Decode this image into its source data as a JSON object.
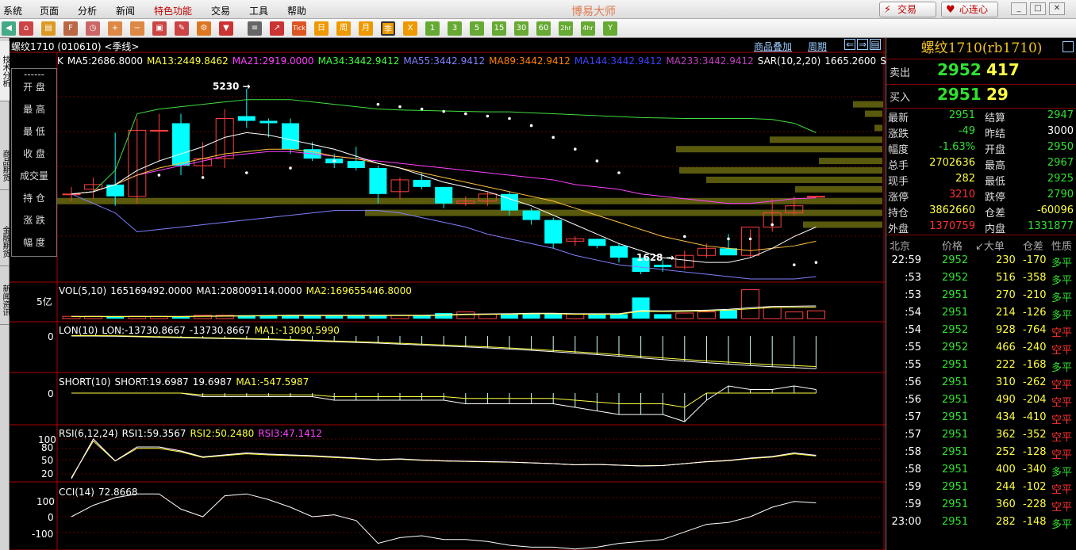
{
  "menu": [
    "系统",
    "页面",
    "分析",
    "新闻",
    "特色功能",
    "交易",
    "工具",
    "帮助"
  ],
  "app_title": "博易大师",
  "top_buttons": {
    "trade": "交易",
    "heart": "心连心"
  },
  "toolbar_labels": {
    "tick": "Tick",
    "day": "日",
    "week": "周",
    "month": "月",
    "season": "季",
    "x": "X",
    "m1": "1",
    "m3": "3",
    "m5": "5",
    "m15": "15",
    "m30": "30",
    "m60": "60",
    "h2": "2hr",
    "h4": "4hr",
    "y": "Y"
  },
  "left_tabs": [
    "技术分析",
    "商品期货",
    "金融期货",
    "新闻资讯"
  ],
  "chart": {
    "contract": "螺纹1710 (010610) <季线>",
    "links": [
      "商品叠加",
      "周期"
    ],
    "ma_line": [
      {
        "t": "K",
        "c": "#ffffff"
      },
      {
        "t": "MA5:2686.8000",
        "c": "#ffffff"
      },
      {
        "t": "MA13:2449.8462",
        "c": "#ffff40"
      },
      {
        "t": "MA21:2919.0000",
        "c": "#ff40ff"
      },
      {
        "t": "MA34:3442.9412",
        "c": "#40ff40"
      },
      {
        "t": "MA55:3442.9412",
        "c": "#8080ff"
      },
      {
        "t": "MA89:3442.9412",
        "c": "#ff8000"
      },
      {
        "t": "MA144:3442.9412",
        "c": "#4040ff"
      },
      {
        "t": "MA233:3442.9412",
        "c": "#c040c0"
      },
      {
        "t": "SAR(10,2,20)",
        "c": "#ffffff"
      },
      {
        "t": "1665.2600",
        "c": "#ffffff"
      },
      {
        "t": "SSLO",
        "c": "#ffffff"
      },
      {
        "t": "2990.5",
        "c": "#ffff40"
      }
    ],
    "side_panel": [
      "------",
      "开 盘",
      "最 高",
      "最 低",
      "收 盘",
      "成交量",
      "持 仓",
      "涨 跌",
      "幅 度"
    ],
    "price_labels": {
      "high": "5230",
      "low": "1628"
    },
    "vol_line": [
      {
        "t": "VOL(5,10)",
        "c": "#ffffff"
      },
      {
        "t": "165169492.0000",
        "c": "#ffffff"
      },
      {
        "t": "MA1:208009114.0000",
        "c": "#ffffff"
      },
      {
        "t": "MA2:169655446.8000",
        "c": "#ffff40"
      }
    ],
    "vol_axis": "5亿",
    "lon_line": [
      {
        "t": "LON(10)",
        "c": "#ffffff"
      },
      {
        "t": "LON:-13730.8667",
        "c": "#ffffff"
      },
      {
        "t": "-13730.8667",
        "c": "#ffffff"
      },
      {
        "t": "MA1:-13090.5990",
        "c": "#ffff40"
      }
    ],
    "lon_axis": "0",
    "short_line": [
      {
        "t": "SHORT(10)",
        "c": "#ffffff"
      },
      {
        "t": "SHORT:19.6987",
        "c": "#ffffff"
      },
      {
        "t": "19.6987",
        "c": "#ffffff"
      },
      {
        "t": "MA1:-547.5987",
        "c": "#ffff40"
      }
    ],
    "short_axis": "0",
    "rsi_line": [
      {
        "t": "RSI(6,12,24)",
        "c": "#ffffff"
      },
      {
        "t": "RSI1:59.3567",
        "c": "#ffffff"
      },
      {
        "t": "RSI2:50.2480",
        "c": "#ffff40"
      },
      {
        "t": "RSI3:47.1412",
        "c": "#ff40ff"
      }
    ],
    "rsi_axis": [
      "100",
      "80",
      "50",
      "20"
    ],
    "cci_line": [
      {
        "t": "CCI(14)",
        "c": "#ffffff"
      },
      {
        "t": "72.8668",
        "c": "#ffffff"
      }
    ],
    "cci_axis": [
      "100",
      "0",
      "-100"
    ]
  },
  "chart_data": {
    "type": "candlestick",
    "title": "螺纹1710 (010610) <季线>",
    "price_ylim": [
      1200,
      5700
    ],
    "candles": [
      {
        "o": 3000,
        "h": 3150,
        "l": 2850,
        "c": 3000
      },
      {
        "o": 3100,
        "h": 3350,
        "l": 2900,
        "c": 3200
      },
      {
        "o": 3200,
        "h": 4300,
        "l": 2750,
        "c": 2950
      },
      {
        "o": 2950,
        "h": 4600,
        "l": 2800,
        "c": 4350
      },
      {
        "o": 4350,
        "h": 4700,
        "l": 3700,
        "c": 4350
      },
      {
        "o": 4500,
        "h": 4700,
        "l": 3400,
        "c": 3600
      },
      {
        "o": 3600,
        "h": 4100,
        "l": 3400,
        "c": 3750
      },
      {
        "o": 3750,
        "h": 4800,
        "l": 3550,
        "c": 4600
      },
      {
        "o": 4650,
        "h": 5230,
        "l": 4400,
        "c": 4550
      },
      {
        "o": 4550,
        "h": 4600,
        "l": 4200,
        "c": 4500
      },
      {
        "o": 4500,
        "h": 4600,
        "l": 3850,
        "c": 3950
      },
      {
        "o": 3950,
        "h": 4100,
        "l": 3700,
        "c": 3750
      },
      {
        "o": 3750,
        "h": 3850,
        "l": 3550,
        "c": 3650
      },
      {
        "o": 3700,
        "h": 4000,
        "l": 3500,
        "c": 3550
      },
      {
        "o": 3550,
        "h": 3600,
        "l": 2800,
        "c": 3000
      },
      {
        "o": 3050,
        "h": 3350,
        "l": 2900,
        "c": 3300
      },
      {
        "o": 3300,
        "h": 3450,
        "l": 3100,
        "c": 3150
      },
      {
        "o": 3150,
        "h": 3150,
        "l": 2700,
        "c": 2800
      },
      {
        "o": 2800,
        "h": 2950,
        "l": 2750,
        "c": 2850
      },
      {
        "o": 2850,
        "h": 3050,
        "l": 2750,
        "c": 3000
      },
      {
        "o": 3000,
        "h": 3050,
        "l": 2550,
        "c": 2650
      },
      {
        "o": 2650,
        "h": 2700,
        "l": 2350,
        "c": 2450
      },
      {
        "o": 2450,
        "h": 2500,
        "l": 1850,
        "c": 1950
      },
      {
        "o": 2000,
        "h": 2100,
        "l": 1900,
        "c": 2050
      },
      {
        "o": 2050,
        "h": 2050,
        "l": 1850,
        "c": 1900
      },
      {
        "o": 1900,
        "h": 1950,
        "l": 1550,
        "c": 1650
      },
      {
        "o": 1650,
        "h": 1650,
        "l": 1300,
        "c": 1350
      },
      {
        "o": 1500,
        "h": 1600,
        "l": 1350,
        "c": 1450
      },
      {
        "o": 1450,
        "h": 1800,
        "l": 1400,
        "c": 1700
      },
      {
        "o": 1700,
        "h": 1950,
        "l": 1650,
        "c": 1850
      },
      {
        "o": 1850,
        "h": 2150,
        "l": 1750,
        "c": 1700
      },
      {
        "o": 1700,
        "h": 2250,
        "l": 1650,
        "c": 2300
      },
      {
        "o": 2300,
        "h": 2900,
        "l": 2200,
        "c": 2600
      },
      {
        "o": 2600,
        "h": 2950,
        "l": 2550,
        "c": 2750
      },
      {
        "o": 2950,
        "h": 2967,
        "l": 2925,
        "c": 2951
      }
    ],
    "ma5": [
      3000,
      3050,
      3200,
      3500,
      3700,
      3850,
      4000,
      4200,
      4300,
      4250,
      4150,
      4050,
      3950,
      3800,
      3650,
      3550,
      3400,
      3250,
      3150,
      3050,
      2900,
      2750,
      2550,
      2350,
      2150,
      1950,
      1800,
      1650,
      1600,
      1550,
      1550,
      1650,
      1850,
      2100,
      2300
    ],
    "ma13": [
      3000,
      3050,
      3200,
      3400,
      3550,
      3650,
      3750,
      3850,
      3900,
      3950,
      3950,
      3900,
      3800,
      3750,
      3650,
      3550,
      3450,
      3350,
      3250,
      3150,
      3050,
      2950,
      2850,
      2700,
      2550,
      2400,
      2250,
      2100,
      2000,
      1900,
      1850,
      1800,
      1850,
      1900,
      2000
    ],
    "ma21": [
      3000,
      3050,
      3200,
      3400,
      3500,
      3600,
      3700,
      3800,
      3850,
      3900,
      3900,
      3850,
      3800,
      3750,
      3700,
      3650,
      3600,
      3550,
      3500,
      3450,
      3400,
      3350,
      3300,
      3200,
      3150,
      3100,
      3000,
      2950,
      2900,
      2850,
      2800,
      2800,
      2850,
      2900,
      2919
    ],
    "ma34": [
      3000,
      3050,
      3500,
      4700,
      4800,
      4850,
      4900,
      4950,
      5000,
      5000,
      5000,
      4950,
      4900,
      4850,
      4800,
      4780,
      4770,
      4760,
      4750,
      4740,
      4740,
      4720,
      4700,
      4680,
      4660,
      4640,
      4620,
      4610,
      4600,
      4600,
      4600,
      4600,
      4580,
      4500,
      4300
    ],
    "ma55": [
      3000,
      2800,
      2600,
      2200,
      2250,
      2300,
      2350,
      2400,
      2450,
      2500,
      2550,
      2600,
      2650,
      2650,
      2650,
      2600,
      2500,
      2400,
      2300,
      2150,
      2050,
      1950,
      1850,
      1700,
      1600,
      1500,
      1450,
      1400,
      1350,
      1300,
      1250,
      1200,
      1200,
      1200,
      1250
    ],
    "sar": [
      null,
      null,
      null,
      null,
      null,
      null,
      null,
      null,
      null,
      null,
      null,
      null,
      null,
      null,
      4900,
      4850,
      4800,
      4750,
      4700,
      4650,
      4600,
      4450,
      4200,
      3950,
      3700,
      3450,
      null,
      null,
      null,
      null,
      null,
      null,
      null,
      null,
      null
    ],
    "volume": [
      0.2,
      0.2,
      0.2,
      0.2,
      0.2,
      0.2,
      0.3,
      0.3,
      0.3,
      0.3,
      0.3,
      0.3,
      0.3,
      0.3,
      0.3,
      0.3,
      0.3,
      0.5,
      0.6,
      0.4,
      0.4,
      0.5,
      0.5,
      0.4,
      0.4,
      0.4,
      1.9,
      0.4,
      0.5,
      0.6,
      0.8,
      2.6,
      1.0,
      0.6,
      0.7
    ],
    "lon": [
      0,
      0,
      -100,
      -300,
      -500,
      -700,
      -900,
      -1100,
      -1300,
      -1500,
      -1800,
      -2100,
      -2400,
      -2700,
      -3000,
      -3400,
      -3800,
      -4200,
      -4600,
      -5000,
      -5500,
      -6000,
      -6600,
      -7200,
      -7800,
      -8500,
      -9200,
      -9900,
      -10600,
      -11200,
      -11800,
      -12400,
      -12900,
      -13300,
      -13731
    ],
    "short": [
      0,
      0,
      0,
      0,
      0,
      0,
      -1,
      -1,
      -1,
      -1,
      -1,
      -1,
      -2,
      -2,
      -2,
      -2,
      -2,
      -2,
      -3,
      -3,
      -3,
      -3,
      -3,
      -4,
      -5,
      -6,
      -6,
      -6,
      -8,
      -2,
      2,
      1,
      1,
      2,
      1
    ],
    "rsi": [
      0,
      100,
      45,
      80,
      80,
      70,
      55,
      60,
      65,
      62,
      60,
      58,
      55,
      52,
      48,
      50,
      47,
      45,
      44,
      43,
      42,
      40,
      38,
      35,
      36,
      34,
      32,
      33,
      38,
      43,
      46,
      52,
      56,
      65,
      59
    ],
    "cci": [
      0,
      60,
      100,
      120,
      120,
      40,
      0,
      110,
      120,
      90,
      50,
      0,
      10,
      -20,
      -140,
      -110,
      -100,
      -120,
      -120,
      -130,
      -150,
      -160,
      -160,
      -170,
      -160,
      -140,
      -130,
      -120,
      -80,
      -40,
      -30,
      0,
      50,
      80,
      73
    ]
  },
  "quote": {
    "title": "螺纹1710(rb1710)",
    "sell": {
      "label": "卖出",
      "price": "2952",
      "vol": "417"
    },
    "buy": {
      "label": "买入",
      "price": "2951",
      "vol": "29"
    },
    "fields": [
      {
        "l1": "最新",
        "v1": "2951",
        "c1": "green",
        "l2": "结算",
        "v2": "2947",
        "c2": "green"
      },
      {
        "l1": "涨跌",
        "v1": "-49",
        "c1": "green",
        "l2": "昨结",
        "v2": "3000",
        "c2": "white"
      },
      {
        "l1": "幅度",
        "v1": "-1.63%",
        "c1": "green",
        "l2": "开盘",
        "v2": "2950",
        "c2": "green"
      },
      {
        "l1": "总手",
        "v1": "2702636",
        "c1": "yellow",
        "l2": "最高",
        "v2": "2967",
        "c2": "green"
      },
      {
        "l1": "现手",
        "v1": "282",
        "c1": "yellow",
        "l2": "最低",
        "v2": "2925",
        "c2": "green"
      },
      {
        "l1": "涨停",
        "v1": "3210",
        "c1": "red",
        "l2": "跌停",
        "v2": "2790",
        "c2": "green"
      },
      {
        "l1": "持仓",
        "v1": "3862660",
        "c1": "yellow",
        "l2": "仓差",
        "v2": "-60096",
        "c2": "yellow"
      },
      {
        "l1": "外盘",
        "v1": "1370759",
        "c1": "red",
        "l2": "内盘",
        "v2": "1331877",
        "c2": "green"
      }
    ],
    "table_headers": [
      "北京",
      "价格",
      "↙大单",
      "仓差",
      "性质"
    ],
    "ticks": [
      {
        "t": "22:59",
        "p": "2952",
        "v": "230",
        "d": "-170",
        "n": "多平",
        "nc": "green"
      },
      {
        "t": ":53",
        "p": "2952",
        "v": "516",
        "d": "-358",
        "n": "多平",
        "nc": "green"
      },
      {
        "t": ":53",
        "p": "2951",
        "v": "270",
        "d": "-210",
        "n": "多平",
        "nc": "green"
      },
      {
        "t": ":54",
        "p": "2951",
        "v": "214",
        "d": "-126",
        "n": "多平",
        "nc": "green"
      },
      {
        "t": ":54",
        "p": "2952",
        "v": "928",
        "d": "-764",
        "n": "空平",
        "nc": "red"
      },
      {
        "t": ":55",
        "p": "2952",
        "v": "466",
        "d": "-240",
        "n": "空平",
        "nc": "red"
      },
      {
        "t": ":55",
        "p": "2951",
        "v": "222",
        "d": "-168",
        "n": "多平",
        "nc": "green"
      },
      {
        "t": ":56",
        "p": "2951",
        "v": "310",
        "d": "-262",
        "n": "空平",
        "nc": "red"
      },
      {
        "t": ":56",
        "p": "2951",
        "v": "490",
        "d": "-204",
        "n": "空平",
        "nc": "red"
      },
      {
        "t": ":57",
        "p": "2951",
        "v": "434",
        "d": "-410",
        "n": "空平",
        "nc": "red"
      },
      {
        "t": ":57",
        "p": "2951",
        "v": "362",
        "d": "-352",
        "n": "空平",
        "nc": "red"
      },
      {
        "t": ":58",
        "p": "2951",
        "v": "252",
        "d": "-128",
        "n": "空平",
        "nc": "red"
      },
      {
        "t": ":58",
        "p": "2951",
        "v": "400",
        "d": "-340",
        "n": "多平",
        "nc": "green"
      },
      {
        "t": ":59",
        "p": "2951",
        "v": "244",
        "d": "-102",
        "n": "空平",
        "nc": "red"
      },
      {
        "t": ":59",
        "p": "2951",
        "v": "360",
        "d": "-228",
        "n": "空平",
        "nc": "red"
      },
      {
        "t": "23:00",
        "p": "2951",
        "v": "282",
        "d": "-148",
        "n": "多平",
        "nc": "green"
      }
    ]
  }
}
